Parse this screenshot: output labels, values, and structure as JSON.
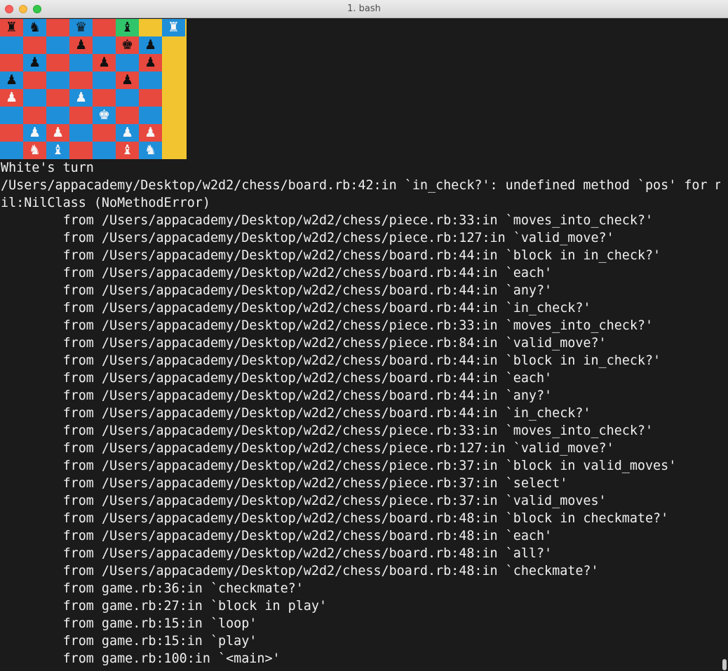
{
  "window": {
    "title": "1. bash"
  },
  "board": {
    "rows": [
      [
        {
          "color": "red",
          "piece": "♜",
          "side": "black"
        },
        {
          "color": "blue",
          "piece": "♞",
          "side": "black"
        },
        {
          "color": "red",
          "piece": "",
          "side": ""
        },
        {
          "color": "blue",
          "piece": "♛",
          "side": "black"
        },
        {
          "color": "red",
          "piece": "",
          "side": ""
        },
        {
          "color": "green",
          "piece": "♝",
          "side": "black"
        },
        {
          "color": "yellow",
          "piece": "",
          "side": ""
        },
        {
          "color": "blue",
          "piece": "♜",
          "side": "white"
        }
      ],
      [
        {
          "color": "blue",
          "piece": "",
          "side": ""
        },
        {
          "color": "red",
          "piece": "",
          "side": ""
        },
        {
          "color": "blue",
          "piece": "",
          "side": ""
        },
        {
          "color": "red",
          "piece": "♟",
          "side": "black"
        },
        {
          "color": "blue",
          "piece": "",
          "side": ""
        },
        {
          "color": "red",
          "piece": "♚",
          "side": "black"
        },
        {
          "color": "blue",
          "piece": "♟",
          "side": "black"
        },
        {
          "color": "yellow",
          "piece": "",
          "side": ""
        }
      ],
      [
        {
          "color": "red",
          "piece": "",
          "side": ""
        },
        {
          "color": "blue",
          "piece": "♟",
          "side": "black"
        },
        {
          "color": "red",
          "piece": "",
          "side": ""
        },
        {
          "color": "blue",
          "piece": "",
          "side": ""
        },
        {
          "color": "red",
          "piece": "♟",
          "side": "black"
        },
        {
          "color": "blue",
          "piece": "",
          "side": ""
        },
        {
          "color": "red",
          "piece": "♟",
          "side": "black"
        },
        {
          "color": "yellow",
          "piece": "",
          "side": ""
        }
      ],
      [
        {
          "color": "blue",
          "piece": "♟",
          "side": "black"
        },
        {
          "color": "red",
          "piece": "",
          "side": ""
        },
        {
          "color": "blue",
          "piece": "",
          "side": ""
        },
        {
          "color": "red",
          "piece": "",
          "side": ""
        },
        {
          "color": "blue",
          "piece": "",
          "side": ""
        },
        {
          "color": "red",
          "piece": "♟",
          "side": "black"
        },
        {
          "color": "blue",
          "piece": "",
          "side": ""
        },
        {
          "color": "yellow",
          "piece": "",
          "side": ""
        }
      ],
      [
        {
          "color": "red",
          "piece": "♟",
          "side": "white"
        },
        {
          "color": "blue",
          "piece": "",
          "side": ""
        },
        {
          "color": "red",
          "piece": "",
          "side": ""
        },
        {
          "color": "blue",
          "piece": "♟",
          "side": "white"
        },
        {
          "color": "red",
          "piece": "",
          "side": ""
        },
        {
          "color": "blue",
          "piece": "",
          "side": ""
        },
        {
          "color": "red",
          "piece": "",
          "side": ""
        },
        {
          "color": "yellow",
          "piece": "",
          "side": ""
        }
      ],
      [
        {
          "color": "blue",
          "piece": "",
          "side": ""
        },
        {
          "color": "red",
          "piece": "",
          "side": ""
        },
        {
          "color": "blue",
          "piece": "",
          "side": ""
        },
        {
          "color": "red",
          "piece": "",
          "side": ""
        },
        {
          "color": "blue",
          "piece": "♚",
          "side": "white"
        },
        {
          "color": "red",
          "piece": "",
          "side": ""
        },
        {
          "color": "blue",
          "piece": "",
          "side": ""
        },
        {
          "color": "yellow",
          "piece": "",
          "side": ""
        }
      ],
      [
        {
          "color": "red",
          "piece": "",
          "side": ""
        },
        {
          "color": "blue",
          "piece": "♟",
          "side": "white"
        },
        {
          "color": "red",
          "piece": "♟",
          "side": "white"
        },
        {
          "color": "blue",
          "piece": "",
          "side": ""
        },
        {
          "color": "red",
          "piece": "",
          "side": ""
        },
        {
          "color": "blue",
          "piece": "♟",
          "side": "white"
        },
        {
          "color": "red",
          "piece": "♟",
          "side": "white"
        },
        {
          "color": "yellow",
          "piece": "",
          "side": ""
        }
      ],
      [
        {
          "color": "blue",
          "piece": "",
          "side": ""
        },
        {
          "color": "red",
          "piece": "♞",
          "side": "white"
        },
        {
          "color": "blue",
          "piece": "♝",
          "side": "white"
        },
        {
          "color": "red",
          "piece": "",
          "side": ""
        },
        {
          "color": "blue",
          "piece": "",
          "side": ""
        },
        {
          "color": "red",
          "piece": "♝",
          "side": "white"
        },
        {
          "color": "blue",
          "piece": "♞",
          "side": "white"
        },
        {
          "color": "yellow",
          "piece": "",
          "side": ""
        }
      ]
    ]
  },
  "terminal": {
    "lines": [
      "White's turn",
      "/Users/appacademy/Desktop/w2d2/chess/board.rb:42:in `in_check?': undefined method `pos' for n",
      "il:NilClass (NoMethodError)",
      "        from /Users/appacademy/Desktop/w2d2/chess/piece.rb:33:in `moves_into_check?'",
      "        from /Users/appacademy/Desktop/w2d2/chess/piece.rb:127:in `valid_move?'",
      "        from /Users/appacademy/Desktop/w2d2/chess/board.rb:44:in `block in in_check?'",
      "        from /Users/appacademy/Desktop/w2d2/chess/board.rb:44:in `each'",
      "        from /Users/appacademy/Desktop/w2d2/chess/board.rb:44:in `any?'",
      "        from /Users/appacademy/Desktop/w2d2/chess/board.rb:44:in `in_check?'",
      "        from /Users/appacademy/Desktop/w2d2/chess/piece.rb:33:in `moves_into_check?'",
      "        from /Users/appacademy/Desktop/w2d2/chess/piece.rb:84:in `valid_move?'",
      "        from /Users/appacademy/Desktop/w2d2/chess/board.rb:44:in `block in in_check?'",
      "        from /Users/appacademy/Desktop/w2d2/chess/board.rb:44:in `each'",
      "        from /Users/appacademy/Desktop/w2d2/chess/board.rb:44:in `any?'",
      "        from /Users/appacademy/Desktop/w2d2/chess/board.rb:44:in `in_check?'",
      "        from /Users/appacademy/Desktop/w2d2/chess/piece.rb:33:in `moves_into_check?'",
      "        from /Users/appacademy/Desktop/w2d2/chess/piece.rb:127:in `valid_move?'",
      "        from /Users/appacademy/Desktop/w2d2/chess/piece.rb:37:in `block in valid_moves'",
      "        from /Users/appacademy/Desktop/w2d2/chess/piece.rb:37:in `select'",
      "        from /Users/appacademy/Desktop/w2d2/chess/piece.rb:37:in `valid_moves'",
      "        from /Users/appacademy/Desktop/w2d2/chess/board.rb:48:in `block in checkmate?'",
      "        from /Users/appacademy/Desktop/w2d2/chess/board.rb:48:in `each'",
      "        from /Users/appacademy/Desktop/w2d2/chess/board.rb:48:in `all?'",
      "        from /Users/appacademy/Desktop/w2d2/chess/board.rb:48:in `checkmate?'",
      "        from game.rb:36:in `checkmate?'",
      "        from game.rb:27:in `block in play'",
      "        from game.rb:15:in `loop'",
      "        from game.rb:15:in `play'",
      "        from game.rb:100:in `<main>'"
    ]
  },
  "colors": {
    "board_red": "#e7493f",
    "board_blue": "#1f8fd9",
    "board_yellow": "#f2c530",
    "board_green": "#30c56a",
    "terminal_bg": "#1b1b1b",
    "terminal_fg": "#f0f0f0"
  }
}
